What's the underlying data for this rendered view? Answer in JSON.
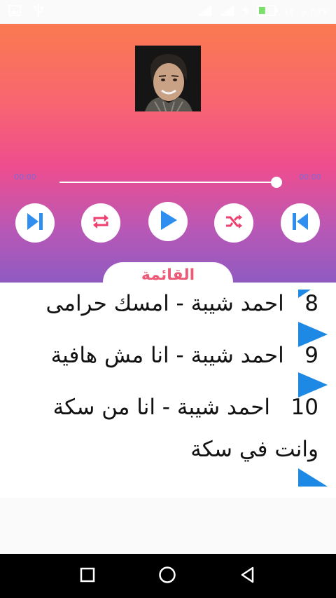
{
  "status": {
    "time": "٣:٣٧ م",
    "battery_percent": "٤٢",
    "battery_level": 0.42,
    "colors": {
      "status_text": "#ffffff"
    }
  },
  "player": {
    "current_time": "00:00",
    "total_time": "00:00",
    "progress": 0.98,
    "playlist_tab_label": "القائمة",
    "colors": {
      "gradient_top": "#fa7a50",
      "gradient_bottom": "#8f5ac2",
      "control_icon": "#2e8ff0",
      "shuffle_repeat_icon": "#ef3f6e"
    }
  },
  "songs": [
    {
      "number": "8",
      "title": "احمد شيبة - امسك حرامى"
    },
    {
      "number": "9",
      "title": "احمد شيبة - انا مش هافية"
    },
    {
      "number": "10",
      "title": "احمد شيبة - انا من سكة",
      "title_line2": "وانت في سكة"
    }
  ],
  "icons": {
    "status": [
      "image-icon",
      "usb-icon",
      "signal-icon",
      "signal-icon",
      "charging-icon",
      "battery-icon"
    ],
    "controls": [
      "skip-next-icon",
      "repeat-icon",
      "play-icon",
      "shuffle-icon",
      "skip-previous-icon"
    ],
    "nav": [
      "recents-icon",
      "home-icon",
      "back-icon"
    ]
  }
}
